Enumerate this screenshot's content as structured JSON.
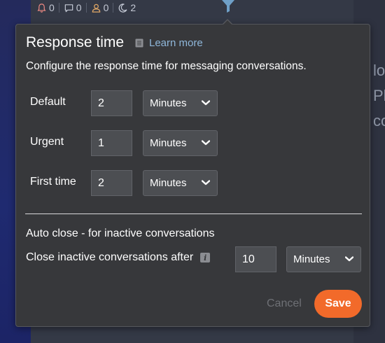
{
  "topbar": {
    "notifications_count": "0",
    "comments_count": "0",
    "contacts_count": "0",
    "snoozed_count": "2"
  },
  "background": {
    "line1": "lo",
    "line2": "Pl",
    "line3": "co"
  },
  "popover": {
    "title": "Response time",
    "learn_more": "Learn more",
    "subtitle": "Configure the response time for messaging conversations.",
    "rows": [
      {
        "label": "Default",
        "value": "2",
        "unit": "Minutes"
      },
      {
        "label": "Urgent",
        "value": "1",
        "unit": "Minutes"
      },
      {
        "label": "First time",
        "value": "2",
        "unit": "Minutes"
      }
    ],
    "auto_close": {
      "section_title": "Auto close - for inactive conversations",
      "label": "Close inactive conversations after",
      "value": "10",
      "unit": "Minutes"
    },
    "cancel_label": "Cancel",
    "save_label": "Save"
  },
  "colors": {
    "accent": "#f26a2a",
    "link": "#8fb7da",
    "popover_bg": "#37383b"
  },
  "icons": [
    "bell-icon",
    "comment-icon",
    "user-icon",
    "moon-icon",
    "filter-icon",
    "document-icon",
    "info-icon",
    "chevron-down-icon"
  ]
}
